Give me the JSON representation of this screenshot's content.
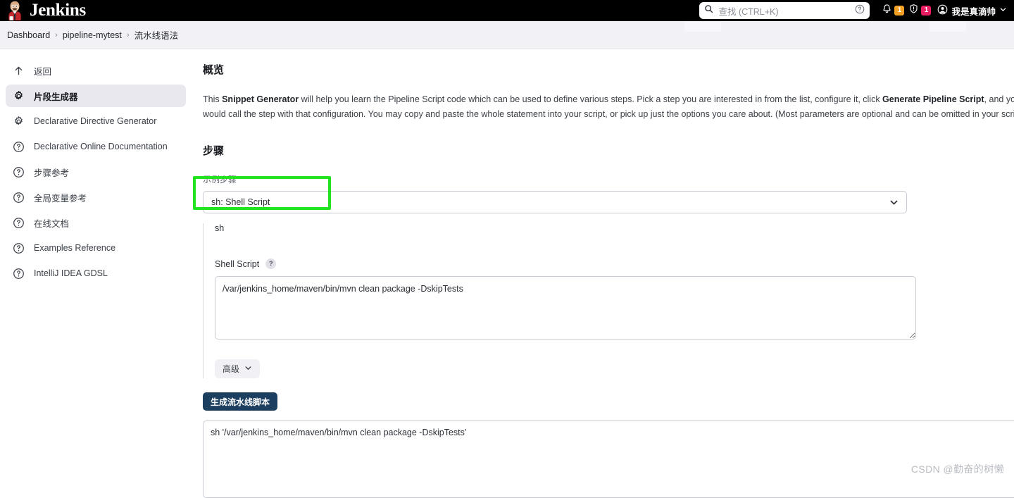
{
  "header": {
    "brand": "Jenkins",
    "logo_icon": "jenkins-butler-logo",
    "search": {
      "icon": "search-icon",
      "placeholder": "查找 (CTRL+K)",
      "value": "",
      "help_icon": "question-circle-icon"
    },
    "notifications": {
      "icon": "bell-icon",
      "count": "1",
      "color": "#f4a024"
    },
    "security": {
      "icon": "shield-exclamation-icon",
      "count": "1",
      "color": "#e81d62"
    },
    "user": {
      "icon": "user-circle-icon",
      "name": "我是真滴帅",
      "chevron_icon": "chevron-down-icon"
    }
  },
  "breadcrumb": {
    "items": [
      {
        "label": "Dashboard"
      },
      {
        "label": "pipeline-mytest"
      },
      {
        "label": "流水线语法"
      }
    ],
    "separator": "›"
  },
  "sidebar": {
    "items": [
      {
        "label": "返回",
        "icon": "arrow-up-icon",
        "active": false
      },
      {
        "label": "片段生成器",
        "icon": "gear-icon",
        "active": true
      },
      {
        "label": "Declarative Directive Generator",
        "icon": "gear-icon",
        "active": false
      },
      {
        "label": "Declarative Online Documentation",
        "icon": "help-circle-icon",
        "active": false
      },
      {
        "label": "步骤参考",
        "icon": "help-circle-icon",
        "active": false
      },
      {
        "label": "全局变量参考",
        "icon": "help-circle-icon",
        "active": false
      },
      {
        "label": "在线文档",
        "icon": "help-circle-icon",
        "active": false
      },
      {
        "label": "Examples Reference",
        "icon": "help-circle-icon",
        "active": false
      },
      {
        "label": "IntelliJ IDEA GDSL",
        "icon": "help-circle-icon",
        "active": false
      }
    ]
  },
  "main": {
    "overview": {
      "title": "概览",
      "p1_a": "This ",
      "p1_b": "Snippet Generator",
      "p1_c": " will help you learn the Pipeline Script code which can be used to define various steps. Pick a step you are interested in from the list, configure it, click ",
      "p1_d": "Generate Pipeline Script",
      "p1_e": ", and you will see a Pipeline Script statement that would call the step with that configuration. You may copy and paste the whole statement into your script, or pick up just the options you care about. (Most parameters are optional and can be omitted in your script, leaving them at default values.)"
    },
    "steps": {
      "title": "步骤",
      "sample_step_label": "示例步骤",
      "selected_step": "sh: Shell Script",
      "select_chevron_icon": "chevron-down-icon",
      "highlight_color": "#22e322"
    },
    "step_form": {
      "block_title": "sh",
      "shell_script_label": "Shell Script",
      "help_icon": "question-mark-icon",
      "help_glyph": "?",
      "script_value": "/var/jenkins_home/maven/bin/mvn clean package -DskipTests",
      "advanced_label": "高级",
      "advanced_chevron_icon": "chevron-down-icon"
    },
    "generate": {
      "button_label": "生成流水线脚本",
      "button_color": "#1c3f60",
      "output_value": "sh '/var/jenkins_home/maven/bin/mvn clean package -DskipTests'"
    }
  },
  "watermark": {
    "text": "CSDN @勤奋的树懒"
  }
}
